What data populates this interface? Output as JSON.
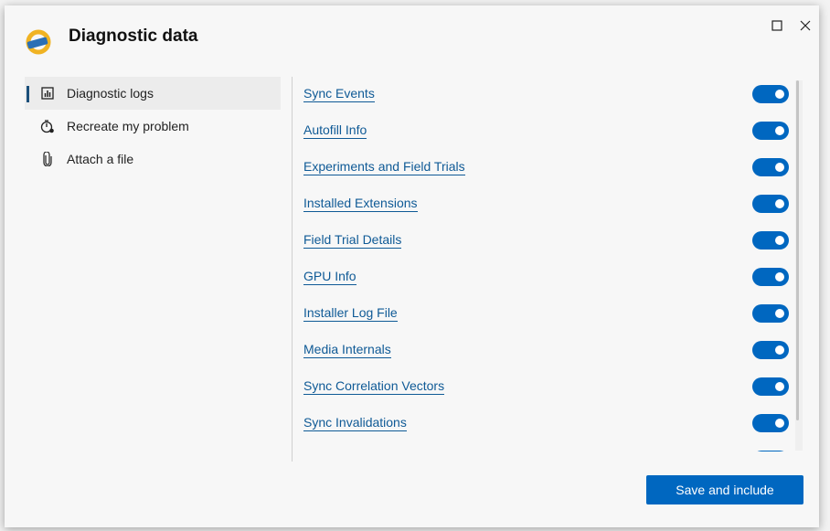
{
  "dialog": {
    "title": "Diagnostic data",
    "logo_text": "CAN"
  },
  "window": {
    "maximize_icon": "maximize-icon",
    "close_icon": "close-icon"
  },
  "nav": {
    "items": [
      {
        "label": "Diagnostic logs",
        "icon": "bar-chart-icon",
        "active": true
      },
      {
        "label": "Recreate my problem",
        "icon": "stopwatch-icon",
        "active": false
      },
      {
        "label": "Attach a file",
        "icon": "paperclip-icon",
        "active": false
      }
    ]
  },
  "logs": {
    "items": [
      {
        "label": "Sync Events",
        "enabled": true
      },
      {
        "label": "Autofill Info",
        "enabled": true
      },
      {
        "label": "Experiments and Field Trials",
        "enabled": true
      },
      {
        "label": "Installed Extensions",
        "enabled": true
      },
      {
        "label": "Field Trial Details",
        "enabled": true
      },
      {
        "label": "GPU Info",
        "enabled": true
      },
      {
        "label": "Installer Log File",
        "enabled": true
      },
      {
        "label": "Media Internals",
        "enabled": true
      },
      {
        "label": "Sync Correlation Vectors",
        "enabled": true
      },
      {
        "label": "Sync Invalidations",
        "enabled": true
      }
    ]
  },
  "footer": {
    "save_label": "Save and include"
  },
  "colors": {
    "accent": "#0067c0",
    "link": "#0f5a96"
  }
}
